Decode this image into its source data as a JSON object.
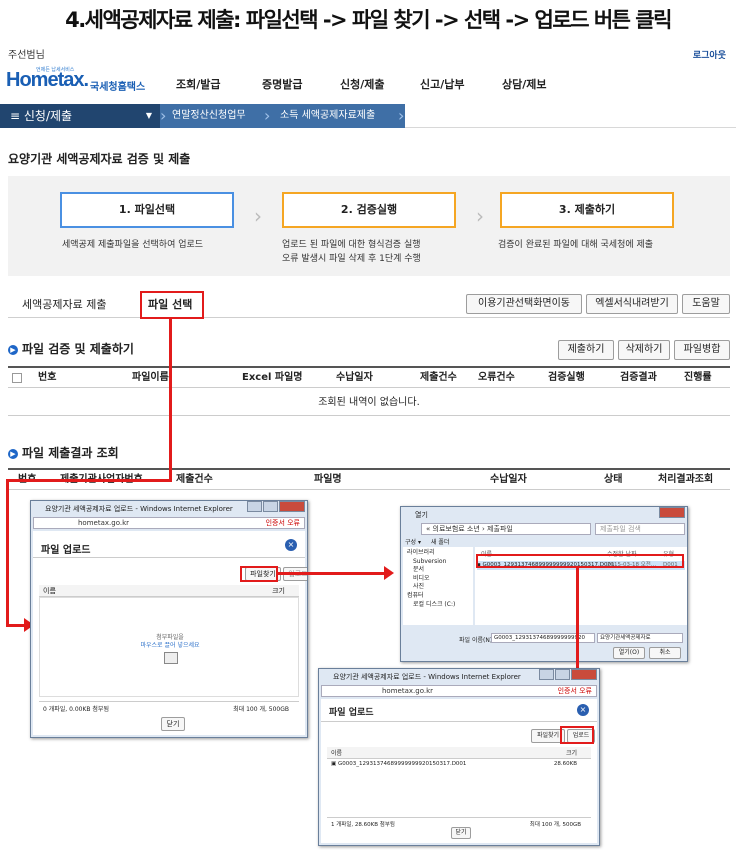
{
  "title": "4.세액공제자료 제출: 파일선택 -> 파일 찾기 -> 선택 -> 업로드 버튼 클릭",
  "header": {
    "user": "주선범님",
    "logout": "로그아웃",
    "logo_tag": "언제든 납세서비스",
    "logo_main": "Hometax.",
    "logo_sub": "국세청홈택스",
    "nav": [
      "조회/발급",
      "증명발급",
      "신청/제출",
      "신고/납부",
      "상담/제보"
    ]
  },
  "navbar": {
    "main": "신청/제출",
    "crumbs": [
      "연말정산신청업무",
      "소득 세액공제자료제출"
    ]
  },
  "page_title": "요양기관 세액공제자료 검증 및 제출",
  "steps": [
    {
      "label": "1. 파일선택",
      "desc": [
        "세액공제 제출파일을 선택하여 업로드"
      ],
      "color": "#4a90e2"
    },
    {
      "label": "2. 검증실행",
      "desc": [
        "업로드 된 파일에 대한 형식검증 실행",
        "오류 발생시 파일 삭제 후 1단계 수행"
      ],
      "color": "#f5a623"
    },
    {
      "label": "3. 제출하기",
      "desc": [
        "검증이 완료된 파일에 대해 국세청에 제출"
      ],
      "color": "#f5a623"
    }
  ],
  "tabs": {
    "tab1": "세액공제자료 제출",
    "tab2": "파일 선택",
    "right_buttons": [
      "이용기관선택화면이동",
      "엑셀서식내려받기",
      "도움말"
    ]
  },
  "section1": {
    "title": "파일 검증 및 제출하기",
    "buttons": [
      "제출하기",
      "삭제하기",
      "파일병합"
    ],
    "columns": [
      "번호",
      "파일이름",
      "Excel 파일명",
      "수납일자",
      "제출건수",
      "오류건수",
      "검증실행",
      "검증결과",
      "진행률"
    ],
    "empty": "조회된 내역이 없습니다."
  },
  "section2": {
    "title": "파일 제출결과 조회",
    "columns": [
      "번호",
      "제출기관사업자번호",
      "제출건수",
      "파일명",
      "수납일자",
      "상태",
      "처리결과조회"
    ]
  },
  "dialog1": {
    "title": "요양기관 세액공제자료 업로드 - Windows Internet Explorer",
    "url": "hometax.go.kr",
    "cert": "인증서 오류",
    "heading": "파일 업로드",
    "find_btn": "파일찾기",
    "upload_btn": "업로드",
    "col_name": "이름",
    "col_size": "크기",
    "drop_hint": "첨부파일을",
    "drop_hint2": "마우스로 끌어 넣으세요",
    "summary_left": "0 개파일, 0.00KB 첨부됨",
    "summary_right": "최대 100 개, 500GB",
    "close": "닫기"
  },
  "open_dialog": {
    "title": "열기",
    "path": "« 의료보험료 소년 › 제출파일",
    "search": "제출파일 검색",
    "organize": "구성 ▾",
    "new_folder": "새 폴더",
    "tree": [
      "라이브러리",
      "Subversion",
      "문서",
      "비디오",
      "사진",
      "컴퓨터",
      "로컬 디스크 (C:)"
    ],
    "col_name": "이름",
    "col_date": "수정한 날짜",
    "col_type": "유형",
    "file": "G0003_129313746899999999920150317.D001",
    "file_date": "2015-03-18 오전...",
    "file_type": "D001",
    "fname_label": "파일 이름(N):",
    "fname_value": "G0003_12931374689999999920",
    "filter": "요양기관세액공제자료",
    "open_btn": "열기(O)",
    "cancel_btn": "취소"
  },
  "dialog2": {
    "title": "요양기관 세액공제자료 업로드 - Windows Internet Explorer",
    "url": "hometax.go.kr",
    "cert": "인증서 오류",
    "heading": "파일 업로드",
    "find_btn": "파일찾기",
    "upload_btn": "업로드",
    "col_name": "이름",
    "col_size": "크기",
    "file": "G0003_12931374689999999920150317.D001",
    "file_size": "28.60KB",
    "summary_left": "1 개파일, 28.60KB 첨부됨",
    "summary_right": "최대 100 개, 500GB",
    "close": "닫기"
  }
}
